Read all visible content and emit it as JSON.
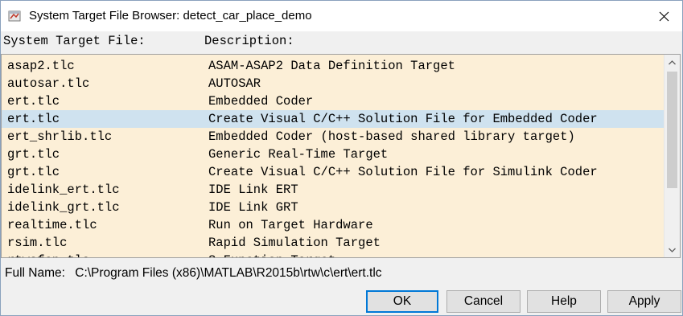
{
  "window": {
    "title": "System Target File Browser: detect_car_place_demo"
  },
  "header": {
    "file_label": "System Target File:",
    "description_label": "Description:"
  },
  "list": {
    "selected_index": 3,
    "rows": [
      {
        "file": "asap2.tlc",
        "description": "ASAM-ASAP2 Data Definition Target"
      },
      {
        "file": "autosar.tlc",
        "description": "AUTOSAR"
      },
      {
        "file": "ert.tlc",
        "description": "Embedded Coder"
      },
      {
        "file": "ert.tlc",
        "description": "Create Visual C/C++ Solution File for Embedded Coder"
      },
      {
        "file": "ert_shrlib.tlc",
        "description": "Embedded Coder (host-based shared library target)"
      },
      {
        "file": "grt.tlc",
        "description": "Generic Real-Time Target"
      },
      {
        "file": "grt.tlc",
        "description": "Create Visual C/C++ Solution File for Simulink Coder"
      },
      {
        "file": "idelink_ert.tlc",
        "description": "IDE Link ERT"
      },
      {
        "file": "idelink_grt.tlc",
        "description": "IDE Link GRT"
      },
      {
        "file": "realtime.tlc",
        "description": "Run on Target Hardware"
      },
      {
        "file": "rsim.tlc",
        "description": "Rapid Simulation Target"
      },
      {
        "file": "rtwsfcn.tlc",
        "description": "S-Function Target"
      }
    ]
  },
  "full_name": {
    "label": "Full Name:",
    "value": "C:\\Program Files (x86)\\MATLAB\\R2015b\\rtw\\c\\ert\\ert.tlc"
  },
  "buttons": {
    "ok": "OK",
    "cancel": "Cancel",
    "help": "Help",
    "apply": "Apply"
  },
  "colors": {
    "list_background": "#fcefd7",
    "selected_row": "#cfe2ef",
    "primary_border": "#0078d7"
  }
}
